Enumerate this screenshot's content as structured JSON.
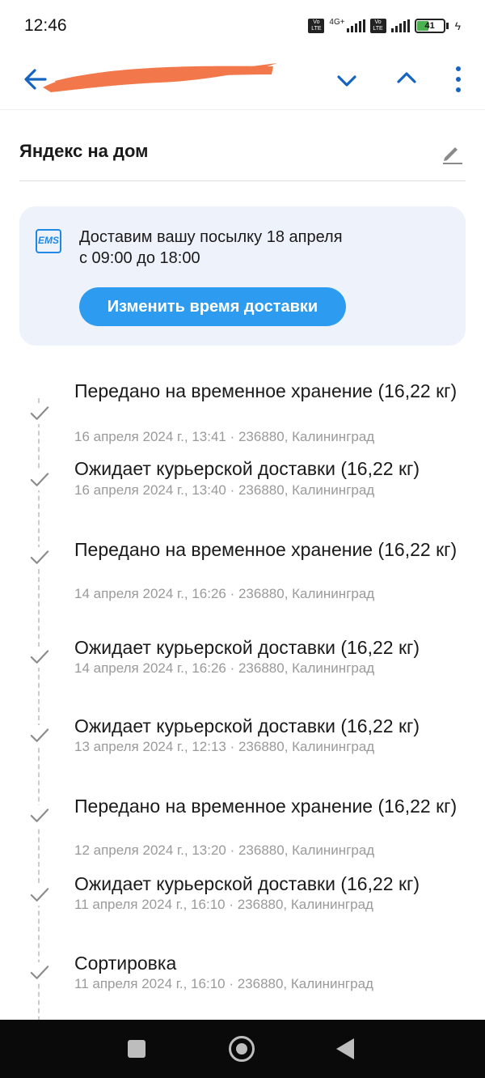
{
  "status_bar": {
    "time": "12:46",
    "volte_label": "Vo\nLTE",
    "network_label": "4G+",
    "battery_level": "41",
    "icons": [
      "volte-icon",
      "signal-icon",
      "volte-icon",
      "signal-icon",
      "battery-icon",
      "charging-icon"
    ]
  },
  "top_bar": {
    "back_icon": "back-arrow-icon",
    "tracking_number_redacted": "",
    "next_icon": "chevron-down-icon",
    "prev_icon": "chevron-up-icon",
    "menu_icon": "more-vertical-icon",
    "accent_color": "#1565c0"
  },
  "parcel": {
    "name": "Яндекс на дом",
    "edit_icon": "pencil-icon"
  },
  "delivery": {
    "carrier_logo": "EMS",
    "text": "Доставим вашу посылку 18 апреля с 09:00 до 18:00",
    "button_label": "Изменить время доставки",
    "button_color": "#2d9cf0",
    "card_color": "#eef3fb"
  },
  "events": [
    {
      "title": "Передано на временное хранение (16,22 кг)",
      "meta": "16 апреля 2024 г., 13:41 · 236880, Калининград"
    },
    {
      "title": "Ожидает курьерской доставки (16,22 кг)",
      "meta": "16 апреля 2024 г., 13:40 · 236880, Калининград"
    },
    {
      "title": "Передано на временное хранение (16,22 кг)",
      "meta": "14 апреля 2024 г., 16:26 · 236880, Калининград"
    },
    {
      "title": "Ожидает курьерской доставки (16,22 кг)",
      "meta": "14 апреля 2024 г., 16:26 · 236880, Калининград"
    },
    {
      "title": "Ожидает курьерской доставки (16,22 кг)",
      "meta": "13 апреля 2024 г., 12:13 · 236880, Калининград"
    },
    {
      "title": "Передано на временное хранение (16,22 кг)",
      "meta": "12 апреля 2024 г., 13:20 · 236880, Калининград"
    },
    {
      "title": "Ожидает курьерской доставки (16,22 кг)",
      "meta": "11 апреля 2024 г., 16:10 · 236880, Калининград"
    },
    {
      "title": "Сортировка",
      "meta": "11 апреля 2024 г., 16:10 · 236880, Калининград"
    }
  ],
  "nav_bar": {
    "recents_icon": "square-icon",
    "home_icon": "circle-icon",
    "back_icon": "triangle-back-icon"
  }
}
